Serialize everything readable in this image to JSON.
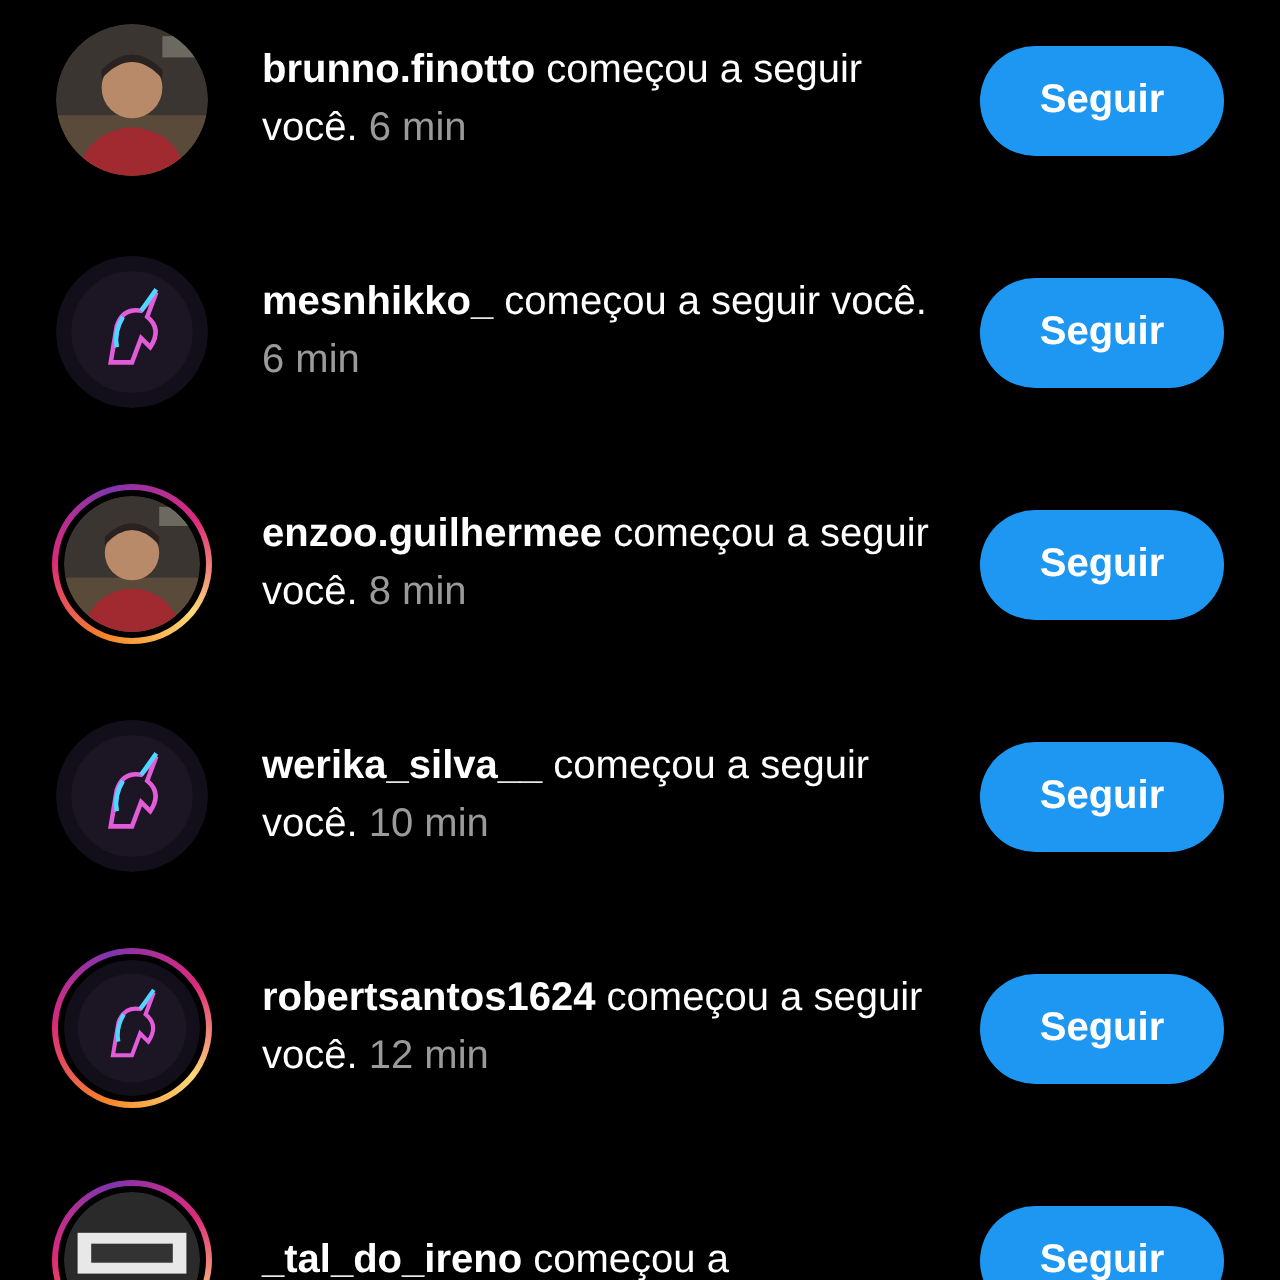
{
  "notifications": [
    {
      "message": "**brunno.finotto** começou a seguir você.",
      "time": "6 min",
      "story_ring": false,
      "button": "Seguir"
    },
    {
      "message": "**mesnhikko_** começou a seguir você.",
      "time": "6 min",
      "story_ring": false,
      "button": "Seguir"
    },
    {
      "message": "**enzoo.guilhermee** começou a seguir você.",
      "time": "8 min",
      "story_ring": true,
      "button": "Seguir"
    },
    {
      "message": "**werika_silva__** começou a seguir você.",
      "time": "10 min",
      "story_ring": false,
      "button": "Seguir"
    },
    {
      "message": "**robertsantos1624** começou a seguir você.",
      "time": "12 min",
      "story_ring": true,
      "button": "Seguir"
    },
    {
      "message": "**_tal_do_ireno** começou a",
      "story_ring": true,
      "button": "Seguir"
    }
  ]
}
